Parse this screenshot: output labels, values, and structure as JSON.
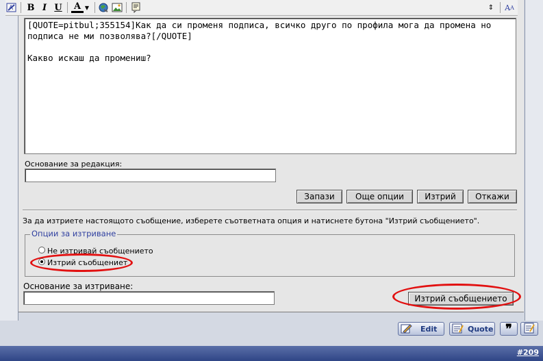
{
  "toolbar": {
    "bold": "B",
    "italic": "I",
    "underline": "U",
    "color": "A",
    "resize": "A"
  },
  "editor": {
    "content": "[QUOTE=pitbul;355154]Как да си променя подписа, всичко друго по профила мога да промена но подписа не ми позволява?[/QUOTE]\n\nКакво искаш да промениш?"
  },
  "edit_reason": {
    "label": "Основание за редакция:",
    "value": ""
  },
  "buttons": {
    "save": "Запази",
    "more_options": "Още опции",
    "delete": "Изтрий",
    "cancel": "Откажи"
  },
  "delete_section": {
    "instruction": "За да изтриете настоящото съобщение, изберете съответната опция и натиснете бутона \"Изтрий съобщението\".",
    "legend": "Опции за изтриване",
    "opt_keep": "Не изтривай съобщението",
    "opt_delete": "Изтрий съобщението",
    "reason_label": "Основание за изтриване:",
    "reason_value": "",
    "delete_button": "Изтрий съобщението"
  },
  "post_actions": {
    "edit": "Edit",
    "quote": "Quote"
  },
  "post_number": "#209",
  "colors": {
    "highlight": "#e21010",
    "legend": "#3040a0",
    "footer": "#2f4586"
  }
}
